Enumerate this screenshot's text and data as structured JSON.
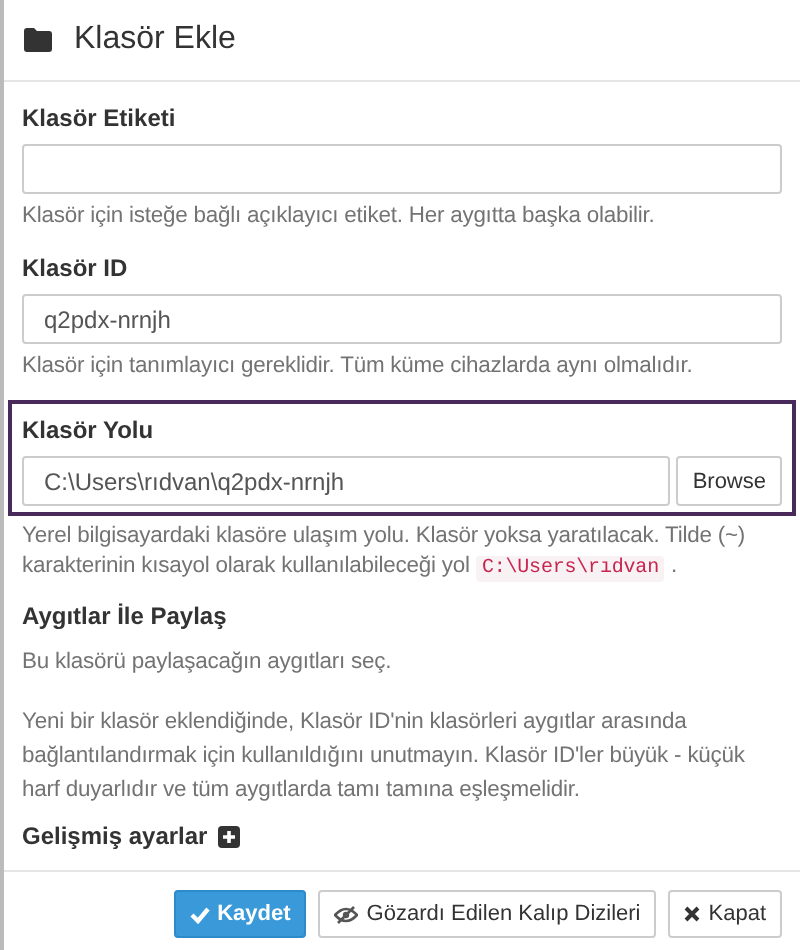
{
  "dialog": {
    "title": "Klasör Ekle"
  },
  "fields": [
    {
      "kind": "text",
      "label": "Klasör Etiketi",
      "help": "Klasör için isteğe bağlı açıklayıcı etiket. Her aygıtta başka olabilir.",
      "highlighted": false
    },
    {
      "kind": "text",
      "label": "Klasör ID",
      "value": "q2pdx-nrnjh",
      "help": "Klasör için tanımlayıcı gereklidir. Tüm küme cihazlarda aynı olmalıdır.",
      "highlighted": false
    },
    {
      "kind": "path",
      "label": "Klasör Yolu",
      "value": "C:\\Users\\rıdvan\\q2pdx-nrnjh",
      "button": "Browse",
      "help": "Yerel bilgisayardaki klasöre ulaşım yolu. Klasör yoksa yaratılacak. Tilde (~) karakterinin kısayol olarak kullanılabileceği yol",
      "help_code": "C:\\Users\\rıdvan",
      "help_end": ".",
      "highlighted": true
    }
  ],
  "share": {
    "heading": "Aygıtlar İle Paylaş",
    "text": "Bu klasörü paylaşacağın aygıtları seç."
  },
  "note": "Yeni bir klasör eklendiğinde, Klasör ID'nin klasörleri aygıtlar arasında bağlantılandırmak için kullanıldığını unutmayın. Klasör ID'ler büyük - küçük harf duyarlıdır ve tüm aygıtlarda tamı tamına eşleşmelidir.",
  "advanced": {
    "label": "Gelişmiş ayarlar",
    "expanded": false
  },
  "buttons": [
    {
      "kind": "save",
      "label": "Kaydet"
    },
    {
      "kind": "patterns",
      "label": "Gözardı Edilen Kalıp Dizileri"
    },
    {
      "kind": "close",
      "label": "Kapat"
    }
  ]
}
